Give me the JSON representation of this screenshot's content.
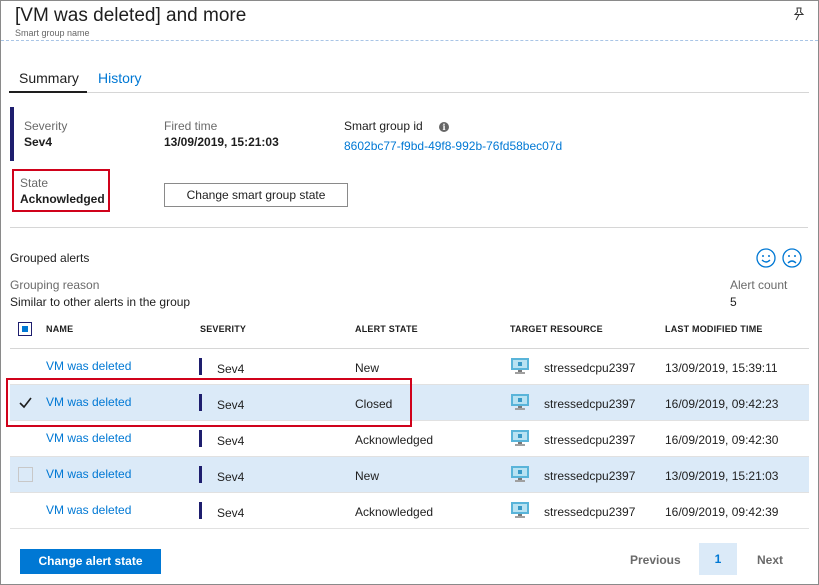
{
  "header": {
    "title": "[VM was deleted] and more",
    "subtitle": "Smart group name"
  },
  "tabs": [
    {
      "label": "Summary",
      "active": true
    },
    {
      "label": "History",
      "active": false
    }
  ],
  "summary": {
    "severity_label": "Severity",
    "severity_value": "Sev4",
    "fired_label": "Fired time",
    "fired_value": "13/09/2019, 15:21:03",
    "id_label": "Smart group id",
    "id_value": "8602bc77-f9bd-49f8-992b-76fd58bec07d",
    "state_label": "State",
    "state_value": "Acknowledged",
    "change_state_button": "Change smart group state"
  },
  "grouped": {
    "title": "Grouped alerts",
    "reason_label": "Grouping reason",
    "reason_value": "Similar to other alerts in the group",
    "count_label": "Alert count",
    "count_value": "5"
  },
  "table": {
    "columns": [
      "NAME",
      "SEVERITY",
      "ALERT STATE",
      "TARGET RESOURCE",
      "LAST MODIFIED TIME"
    ],
    "rows": [
      {
        "name": "VM was deleted",
        "severity": "Sev4",
        "state": "New",
        "resource": "stressedcpu2397",
        "modified": "13/09/2019, 15:39:11",
        "checked": false,
        "selected": false
      },
      {
        "name": "VM was deleted",
        "severity": "Sev4",
        "state": "Closed",
        "resource": "stressedcpu2397",
        "modified": "16/09/2019, 09:42:23",
        "checked": true,
        "selected": true
      },
      {
        "name": "VM was deleted",
        "severity": "Sev4",
        "state": "Acknowledged",
        "resource": "stressedcpu2397",
        "modified": "16/09/2019, 09:42:30",
        "checked": false,
        "selected": false
      },
      {
        "name": "VM was deleted",
        "severity": "Sev4",
        "state": "New",
        "resource": "stressedcpu2397",
        "modified": "13/09/2019, 15:21:03",
        "checked": false,
        "selected": true
      },
      {
        "name": "VM was deleted",
        "severity": "Sev4",
        "state": "Acknowledged",
        "resource": "stressedcpu2397",
        "modified": "16/09/2019, 09:42:39",
        "checked": false,
        "selected": false
      }
    ]
  },
  "footer": {
    "change_alert_state": "Change alert state",
    "previous": "Previous",
    "page": "1",
    "next": "Next"
  },
  "icons": {
    "pin": "pin-icon",
    "info": "info-icon",
    "happy": "smile-icon",
    "sad": "frown-icon",
    "vm": "virtual-machine-icon",
    "check": "checkmark-icon"
  },
  "colors": {
    "accent": "#0078d4",
    "severity": "#1e1e6e",
    "highlight": "#d0021b",
    "selected_row": "#dbeaf8"
  }
}
